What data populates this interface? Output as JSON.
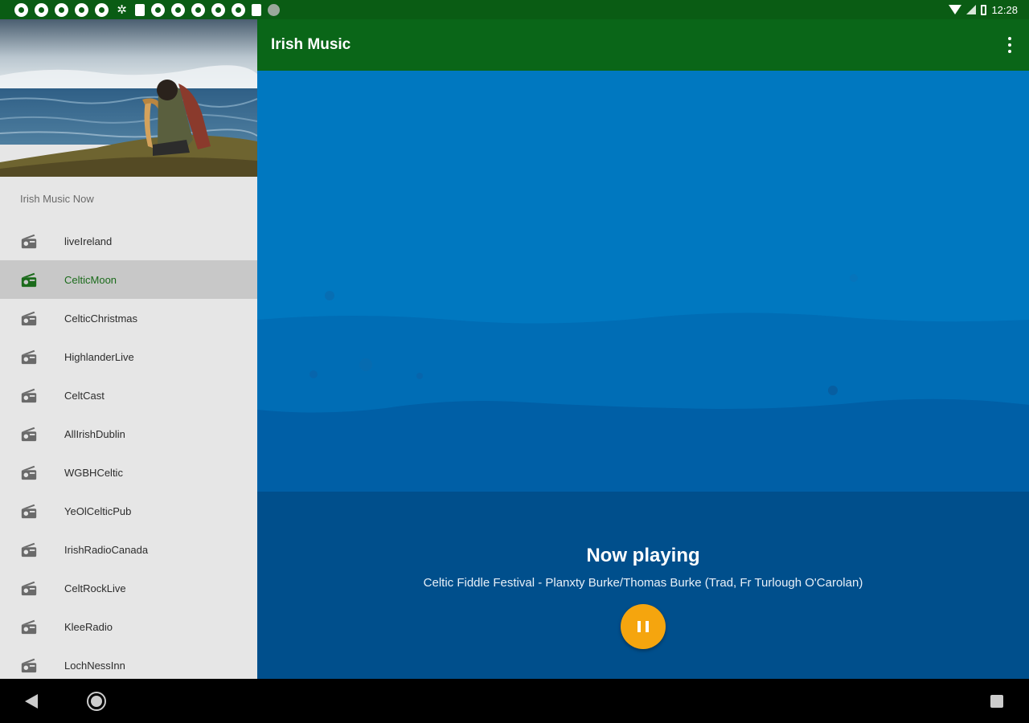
{
  "status_bar": {
    "time": "12:28",
    "notification_icons": [
      "notification-icon",
      "notification-icon",
      "notification-icon",
      "notification-icon",
      "notification-icon",
      "settings-icon",
      "document-icon",
      "notification-icon",
      "notification-icon",
      "notification-icon",
      "notification-icon",
      "notification-icon",
      "sd-card-icon",
      "sync-icon"
    ],
    "status_icons": [
      "wifi-icon",
      "signal-icon",
      "battery-icon"
    ]
  },
  "app_bar": {
    "title": "Irish Music",
    "menu_icon": "more-vertical-icon"
  },
  "drawer": {
    "header_image": "harpist-by-sea-photo",
    "section_title": "Irish Music Now",
    "item_icon": "radio-icon",
    "selected_index": 1,
    "items": [
      {
        "label": "liveIreland"
      },
      {
        "label": "CelticMoon"
      },
      {
        "label": "CelticChristmas"
      },
      {
        "label": "HighlanderLive"
      },
      {
        "label": "CeltCast"
      },
      {
        "label": "AllIrishDublin"
      },
      {
        "label": "WGBHCeltic"
      },
      {
        "label": "YeOlCelticPub"
      },
      {
        "label": "IrishRadioCanada"
      },
      {
        "label": "CeltRockLive"
      },
      {
        "label": "KleeRadio"
      },
      {
        "label": "LochNessInn"
      }
    ]
  },
  "player": {
    "heading": "Now playing",
    "track": "Celtic Fiddle Festival - Planxty Burke/Thomas Burke (Trad, Fr Turlough O'Carolan)",
    "button_icon": "pause-icon"
  },
  "nav_bar": {
    "icons": [
      "back-icon",
      "home-icon",
      "recents-icon"
    ]
  },
  "colors": {
    "status_bar": "#0a5c14",
    "app_bar": "#0a6618",
    "accent": "#f5a50e",
    "selected_text": "#1b6b1b",
    "ocean": "#0078c0",
    "ocean_deep": "#004f8c"
  }
}
